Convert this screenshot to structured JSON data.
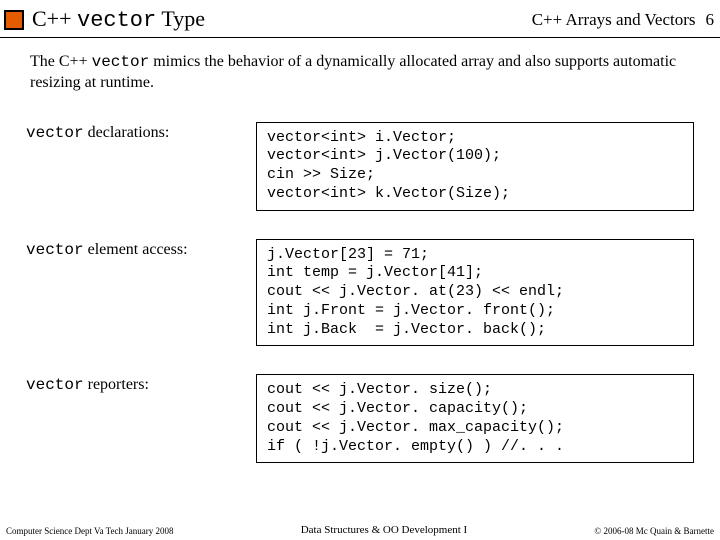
{
  "header": {
    "title_pre": "C++ ",
    "title_mono": "vector",
    "title_post": " Type",
    "chapter": "C++ Arrays and Vectors",
    "pagenum": "6"
  },
  "intro": {
    "pre": "The C++ ",
    "mono": "vector",
    "post": " mimics the behavior of a dynamically allocated array and also supports automatic resizing at runtime."
  },
  "rows": [
    {
      "label_mono": "vector",
      "label_rest": " declarations:",
      "code": "vector<int> i.Vector;\nvector<int> j.Vector(100);\ncin >> Size;\nvector<int> k.Vector(Size);"
    },
    {
      "label_mono": "vector",
      "label_rest": " element access:",
      "code": "j.Vector[23] = 71;\nint temp = j.Vector[41];\ncout << j.Vector. at(23) << endl;\nint j.Front = j.Vector. front();\nint j.Back  = j.Vector. back();"
    },
    {
      "label_mono": "vector",
      "label_rest": " reporters:",
      "code": "cout << j.Vector. size();\ncout << j.Vector. capacity();\ncout << j.Vector. max_capacity();\nif ( !j.Vector. empty() ) //. . ."
    }
  ],
  "footer": {
    "left": "Computer Science Dept Va Tech January 2008",
    "center": "Data Structures & OO Development I",
    "right": "© 2006-08  Mc Quain & Barnette"
  }
}
